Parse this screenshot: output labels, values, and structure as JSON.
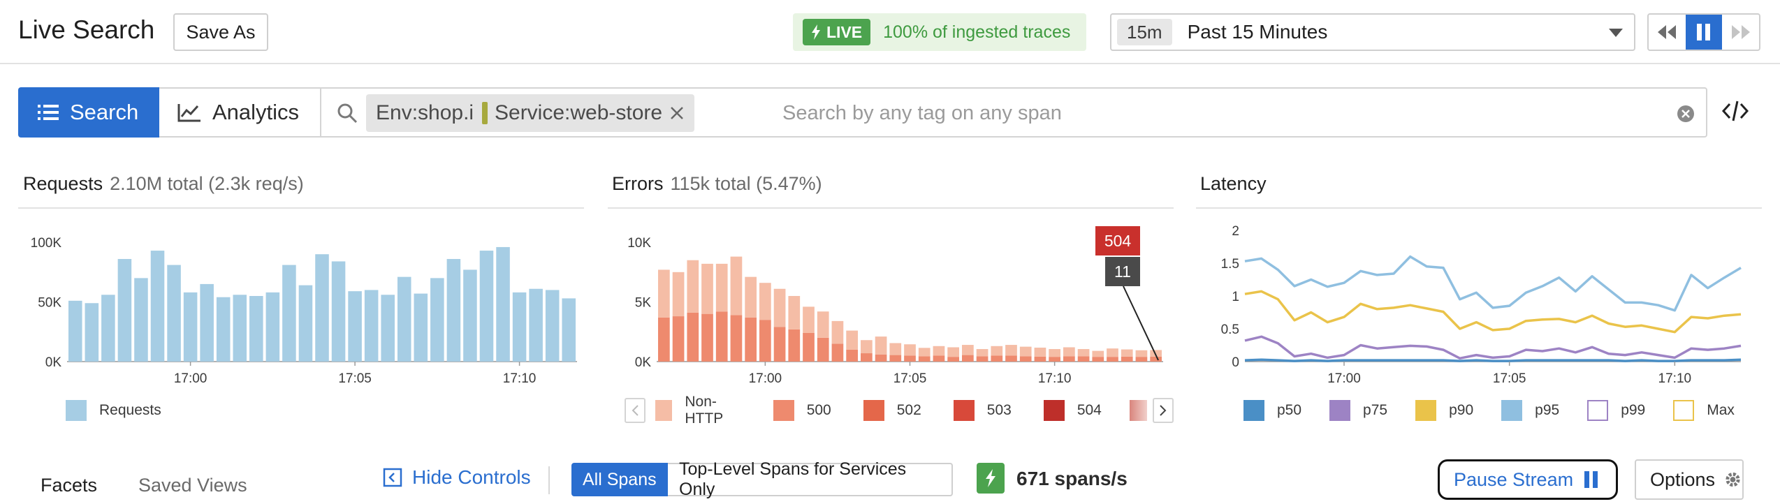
{
  "header": {
    "title": "Live Search",
    "save_as": "Save As",
    "live_badge": "LIVE",
    "live_text": "100% of ingested traces",
    "time_short": "15m",
    "time_label": "Past 15 Minutes"
  },
  "search": {
    "tab_search": "Search",
    "tab_analytics": "Analytics",
    "chips": [
      "Env:shop.ist",
      "Service:web-store"
    ],
    "placeholder": "Search by any tag on any span"
  },
  "panels": {
    "requests": {
      "title": "Requests",
      "subtitle": "2.10M total (2.3k req/s)"
    },
    "errors": {
      "title": "Errors",
      "subtitle": "115k total (5.47%)"
    },
    "latency": {
      "title": "Latency"
    }
  },
  "chart_data": [
    {
      "type": "bar",
      "name": "requests",
      "x_ticks": [
        "17:00",
        "17:05",
        "17:10"
      ],
      "y_ticks": [
        "100K",
        "50K",
        "0K"
      ],
      "ylim": [
        0,
        110000
      ],
      "series": [
        {
          "name": "Requests",
          "color": "#a6cde4",
          "values": [
            51000,
            49000,
            56000,
            86000,
            70000,
            93000,
            81000,
            58000,
            65000,
            54000,
            56000,
            55000,
            58000,
            81000,
            64000,
            90000,
            84000,
            59000,
            60000,
            56000,
            71000,
            57000,
            70000,
            86000,
            77000,
            93000,
            96000,
            58000,
            61000,
            60000,
            53000
          ]
        }
      ]
    },
    {
      "type": "bar",
      "name": "errors",
      "stacked": true,
      "x_ticks": [
        "17:00",
        "17:05",
        "17:10"
      ],
      "y_ticks": [
        "10K",
        "5K",
        "0K"
      ],
      "ylim": [
        0,
        11000
      ],
      "series": [
        {
          "name": "500",
          "color": "#ee8a6e",
          "values": [
            3700,
            3800,
            4100,
            4000,
            4200,
            3900,
            3700,
            3500,
            2900,
            2700,
            2400,
            2000,
            1500,
            1000,
            700,
            600,
            550,
            500,
            450,
            500,
            400,
            550,
            450,
            500,
            500,
            450,
            420,
            400,
            450,
            450,
            400,
            400,
            420,
            400,
            420
          ]
        },
        {
          "name": "Non-HTTP",
          "color": "#f5bda6",
          "values": [
            4000,
            3700,
            4400,
            4200,
            4000,
            4900,
            3400,
            3100,
            3200,
            2800,
            2200,
            2200,
            1900,
            1600,
            1100,
            1500,
            1000,
            950,
            700,
            800,
            800,
            850,
            600,
            800,
            900,
            800,
            750,
            650,
            750,
            600,
            500,
            700,
            600,
            550,
            550
          ]
        }
      ],
      "highlight": {
        "badge_top": "504",
        "badge_bottom": "11"
      }
    },
    {
      "type": "line",
      "name": "latency",
      "x_ticks": [
        "17:00",
        "17:05",
        "17:10"
      ],
      "y_ticks": [
        "2",
        "1.5",
        "1",
        "0.5",
        "0"
      ],
      "ylim": [
        0,
        2
      ],
      "series": [
        {
          "name": "p95",
          "color": "#8fbfe0",
          "values": [
            1.53,
            1.57,
            1.4,
            1.15,
            1.25,
            1.14,
            1.2,
            1.38,
            1.32,
            1.34,
            1.6,
            1.45,
            1.43,
            0.95,
            1.05,
            0.82,
            0.85,
            1.05,
            1.15,
            1.28,
            1.07,
            1.3,
            1.1,
            0.9,
            0.9,
            0.86,
            0.78,
            1.32,
            1.12,
            1.28,
            1.43
          ]
        },
        {
          "name": "p90",
          "color": "#eac34a",
          "values": [
            1.03,
            1.07,
            0.95,
            0.63,
            0.75,
            0.6,
            0.68,
            0.88,
            0.8,
            0.82,
            0.86,
            0.81,
            0.76,
            0.5,
            0.6,
            0.48,
            0.5,
            0.62,
            0.64,
            0.65,
            0.6,
            0.7,
            0.58,
            0.53,
            0.55,
            0.5,
            0.45,
            0.68,
            0.66,
            0.7,
            0.72
          ]
        },
        {
          "name": "p75",
          "color": "#9d83c4",
          "values": [
            0.32,
            0.38,
            0.28,
            0.08,
            0.12,
            0.06,
            0.1,
            0.25,
            0.2,
            0.22,
            0.24,
            0.23,
            0.18,
            0.05,
            0.1,
            0.06,
            0.08,
            0.18,
            0.16,
            0.2,
            0.14,
            0.22,
            0.12,
            0.1,
            0.14,
            0.1,
            0.06,
            0.2,
            0.18,
            0.2,
            0.24
          ]
        },
        {
          "name": "p50",
          "color": "#4a8fc6",
          "values": [
            0.02,
            0.03,
            0.02,
            0.01,
            0.02,
            0.01,
            0.02,
            0.02,
            0.02,
            0.02,
            0.02,
            0.02,
            0.02,
            0.01,
            0.02,
            0.01,
            0.01,
            0.02,
            0.02,
            0.02,
            0.02,
            0.02,
            0.02,
            0.01,
            0.02,
            0.01,
            0.01,
            0.02,
            0.02,
            0.02,
            0.03
          ]
        }
      ]
    }
  ],
  "legends": {
    "requests": [
      {
        "label": "Requests",
        "color": "#a6cde4"
      }
    ],
    "errors": [
      {
        "label": "Non-HTTP",
        "color": "#f5bda6"
      },
      {
        "label": "500",
        "color": "#ee8a6e"
      },
      {
        "label": "502",
        "color": "#e4674a"
      },
      {
        "label": "503",
        "color": "#d8493a"
      },
      {
        "label": "504",
        "color": "#be2f2a"
      }
    ],
    "latency": [
      {
        "label": "p50",
        "color": "#4a8fc6",
        "outline": false
      },
      {
        "label": "p75",
        "color": "#9d83c4",
        "outline": false
      },
      {
        "label": "p90",
        "color": "#eac34a",
        "outline": false
      },
      {
        "label": "p95",
        "color": "#8fbfe0",
        "outline": false
      },
      {
        "label": "p99",
        "color": "#9d83c4",
        "outline": true
      },
      {
        "label": "Max",
        "color": "#eac34a",
        "outline": true
      }
    ]
  },
  "footer": {
    "facets": "Facets",
    "saved_views": "Saved Views",
    "hide_controls": "Hide Controls",
    "all_spans": "All Spans",
    "top_level": "Top-Level Spans for Services Only",
    "rate": "671 spans/s",
    "pause_stream": "Pause Stream",
    "options": "Options"
  },
  "colors": {
    "accent": "#2a6ecf",
    "live_green": "#4ca34e"
  }
}
